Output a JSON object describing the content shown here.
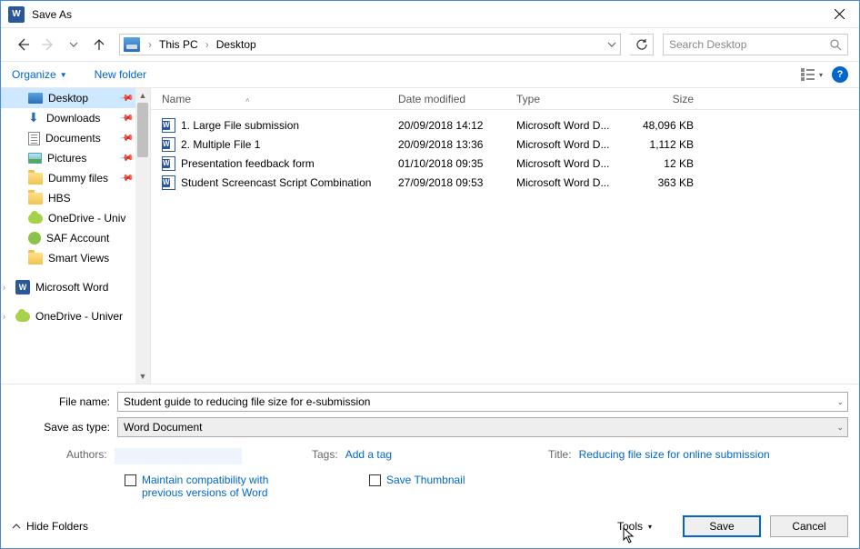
{
  "title": "Save As",
  "nav": {
    "breadcrumb": {
      "loc1": "This PC",
      "loc2": "Desktop"
    },
    "search_placeholder": "Search Desktop"
  },
  "toolbar": {
    "organize": "Organize",
    "new_folder": "New folder"
  },
  "sidebar": {
    "items": [
      {
        "label": "Desktop",
        "kind": "desktop",
        "pinned": true,
        "selected": true
      },
      {
        "label": "Downloads",
        "kind": "download",
        "pinned": true
      },
      {
        "label": "Documents",
        "kind": "doc",
        "pinned": true
      },
      {
        "label": "Pictures",
        "kind": "pic",
        "pinned": true
      },
      {
        "label": "Dummy files",
        "kind": "folder",
        "pinned": true
      },
      {
        "label": "HBS",
        "kind": "folder"
      },
      {
        "label": "OneDrive - Univ",
        "kind": "onedrive",
        "truncated": true
      },
      {
        "label": "SAF Account",
        "kind": "saf"
      },
      {
        "label": "Smart Views",
        "kind": "folder"
      }
    ],
    "roots": [
      {
        "label": "Microsoft Word",
        "kind": "wordapp"
      },
      {
        "label": "OneDrive - Univer",
        "kind": "onedrive",
        "truncated": true
      }
    ]
  },
  "columns": {
    "name": "Name",
    "date": "Date modified",
    "type": "Type",
    "size": "Size"
  },
  "files": [
    {
      "name": "1. Large File submission",
      "date": "20/09/2018 14:12",
      "type": "Microsoft Word D...",
      "size": "48,096 KB"
    },
    {
      "name": "2. Multiple File 1",
      "date": "20/09/2018 13:36",
      "type": "Microsoft Word D...",
      "size": "1,112 KB"
    },
    {
      "name": "Presentation feedback form",
      "date": "01/10/2018 09:35",
      "type": "Microsoft Word D...",
      "size": "12 KB"
    },
    {
      "name": "Student Screencast Script Combination",
      "date": "27/09/2018 09:53",
      "type": "Microsoft Word D...",
      "size": "363 KB"
    }
  ],
  "form": {
    "file_name_label": "File name:",
    "file_name_value": "Student guide to reducing file size for e-submission",
    "save_type_label": "Save as type:",
    "save_type_value": "Word Document",
    "authors_label": "Authors:",
    "tags_label": "Tags:",
    "tags_value": "Add a tag",
    "title_label": "Title:",
    "title_value": "Reducing file size for online submission",
    "compat_label": "Maintain compatibility with previous versions of Word",
    "thumbnail_label": "Save Thumbnail"
  },
  "buttons": {
    "hide_folders": "Hide Folders",
    "tools": "Tools",
    "save": "Save",
    "cancel": "Cancel"
  }
}
